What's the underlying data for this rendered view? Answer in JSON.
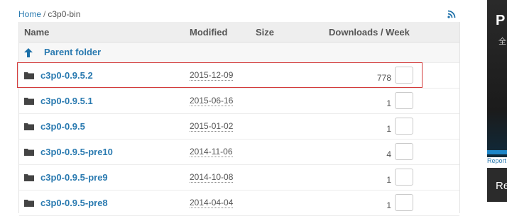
{
  "breadcrumb": {
    "home": "Home",
    "separator": "/",
    "current": "c3p0-bin"
  },
  "table": {
    "headers": {
      "name": "Name",
      "modified": "Modified",
      "size": "Size",
      "downloads": "Downloads / Week"
    },
    "parent_label": "Parent folder",
    "rows": [
      {
        "name": "c3p0-0.9.5.2",
        "modified": "2015-12-09",
        "size": "",
        "downloads": "778"
      },
      {
        "name": "c3p0-0.9.5.1",
        "modified": "2015-06-16",
        "size": "",
        "downloads": "1"
      },
      {
        "name": "c3p0-0.9.5",
        "modified": "2015-01-02",
        "size": "",
        "downloads": "1"
      },
      {
        "name": "c3p0-0.9.5-pre10",
        "modified": "2014-11-06",
        "size": "",
        "downloads": "4"
      },
      {
        "name": "c3p0-0.9.5-pre9",
        "modified": "2014-10-08",
        "size": "",
        "downloads": "1"
      },
      {
        "name": "c3p0-0.9.5-pre8",
        "modified": "2014-04-04",
        "size": "",
        "downloads": "1"
      }
    ]
  },
  "ad": {
    "big_letter": "P",
    "sub_char": "全",
    "report_label": "Report",
    "lower_text": "Re"
  },
  "colors": {
    "link": "#2a7ab0",
    "highlight": "#d33a3a",
    "rss": "#1b6fa8"
  },
  "icons": {
    "rss": "rss-icon",
    "up": "arrow-up-icon",
    "folder": "folder-icon"
  }
}
